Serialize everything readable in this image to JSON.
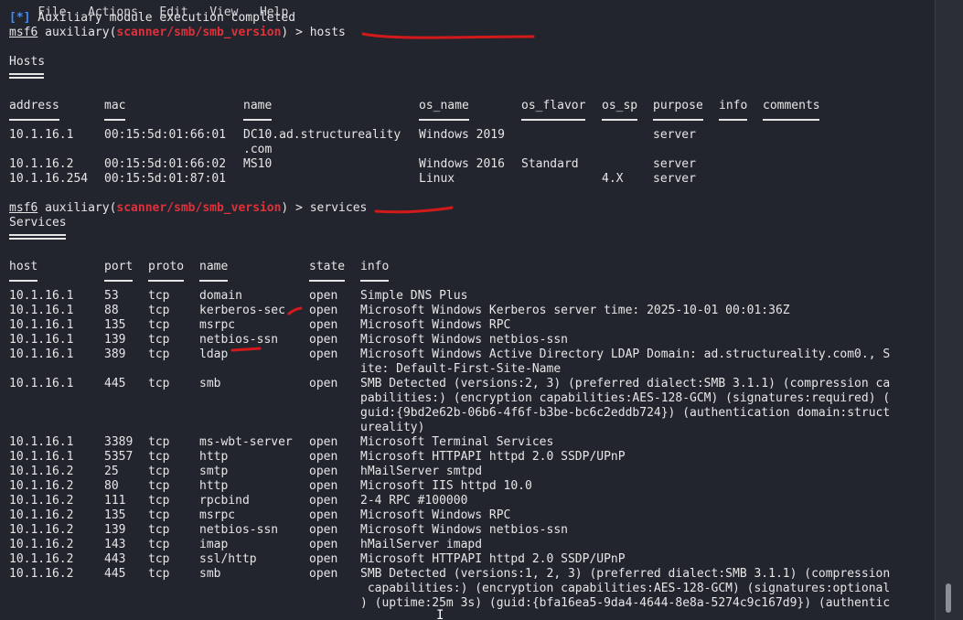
{
  "menu": [
    "File",
    "Actions",
    "Edit",
    "View",
    "Help"
  ],
  "status_prefix": "[*]",
  "status_text": " Auxiliary module execution completed",
  "prompt1": {
    "msf": "msf6",
    "aux": " auxiliary(",
    "module": "scanner/smb/smb_version",
    "tail": ") > hosts"
  },
  "hosts_title": "Hosts",
  "hosts_headers": [
    "address",
    "mac",
    "name",
    "os_name",
    "os_flavor",
    "os_sp",
    "purpose",
    "info",
    "comments"
  ],
  "hosts_rows": [
    [
      "10.1.16.1",
      "00:15:5d:01:66:01",
      "DC10.ad.structureality",
      "Windows 2019",
      "",
      "",
      "server",
      "",
      ""
    ],
    [
      "",
      "",
      ".com",
      "",
      "",
      "",
      "",
      "",
      ""
    ],
    [
      "10.1.16.2",
      "00:15:5d:01:66:02",
      "MS10",
      "Windows 2016",
      "Standard",
      "",
      "server",
      "",
      ""
    ],
    [
      "10.1.16.254",
      "00:15:5d:01:87:01",
      "",
      "Linux",
      "",
      "4.X",
      "server",
      "",
      ""
    ]
  ],
  "prompt2": {
    "msf": "msf6",
    "aux": " auxiliary(",
    "module": "scanner/smb/smb_version",
    "tail": ") > services"
  },
  "services_title": "Services",
  "services_headers": [
    "host",
    "port",
    "proto",
    "name",
    "state",
    "info"
  ],
  "services_rows": [
    [
      "10.1.16.1",
      "53",
      "tcp",
      "domain",
      "open",
      "Simple DNS Plus"
    ],
    [
      "10.1.16.1",
      "88",
      "tcp",
      "kerberos-sec",
      "open",
      "Microsoft Windows Kerberos server time: 2025-10-01 00:01:36Z"
    ],
    [
      "10.1.16.1",
      "135",
      "tcp",
      "msrpc",
      "open",
      "Microsoft Windows RPC"
    ],
    [
      "10.1.16.1",
      "139",
      "tcp",
      "netbios-ssn",
      "open",
      "Microsoft Windows netbios-ssn"
    ],
    [
      "10.1.16.1",
      "389",
      "tcp",
      "ldap",
      "open",
      "Microsoft Windows Active Directory LDAP Domain: ad.structureality.com0., S"
    ],
    [
      "",
      "",
      "",
      "",
      "",
      "ite: Default-First-Site-Name"
    ],
    [
      "10.1.16.1",
      "445",
      "tcp",
      "smb",
      "open",
      "SMB Detected (versions:2, 3) (preferred dialect:SMB 3.1.1) (compression ca"
    ],
    [
      "",
      "",
      "",
      "",
      "",
      "pabilities:) (encryption capabilities:AES-128-GCM) (signatures:required) ("
    ],
    [
      "",
      "",
      "",
      "",
      "",
      "guid:{9bd2e62b-06b6-4f6f-b3be-bc6c2eddb724}) (authentication domain:struct"
    ],
    [
      "",
      "",
      "",
      "",
      "",
      "ureality)"
    ],
    [
      "10.1.16.1",
      "3389",
      "tcp",
      "ms-wbt-server",
      "open",
      "Microsoft Terminal Services"
    ],
    [
      "10.1.16.1",
      "5357",
      "tcp",
      "http",
      "open",
      "Microsoft HTTPAPI httpd 2.0 SSDP/UPnP"
    ],
    [
      "10.1.16.2",
      "25",
      "tcp",
      "smtp",
      "open",
      "hMailServer smtpd"
    ],
    [
      "10.1.16.2",
      "80",
      "tcp",
      "http",
      "open",
      "Microsoft IIS httpd 10.0"
    ],
    [
      "10.1.16.2",
      "111",
      "tcp",
      "rpcbind",
      "open",
      "2-4 RPC #100000"
    ],
    [
      "10.1.16.2",
      "135",
      "tcp",
      "msrpc",
      "open",
      "Microsoft Windows RPC"
    ],
    [
      "10.1.16.2",
      "139",
      "tcp",
      "netbios-ssn",
      "open",
      "Microsoft Windows netbios-ssn"
    ],
    [
      "10.1.16.2",
      "143",
      "tcp",
      "imap",
      "open",
      "hMailServer imapd"
    ],
    [
      "10.1.16.2",
      "443",
      "tcp",
      "ssl/http",
      "open",
      "Microsoft HTTPAPI httpd 2.0 SSDP/UPnP"
    ],
    [
      "10.1.16.2",
      "445",
      "tcp",
      "smb",
      "open",
      "SMB Detected (versions:1, 2, 3) (preferred dialect:SMB 3.1.1) (compression"
    ],
    [
      "",
      "",
      "",
      "",
      "",
      " capabilities:) (encryption capabilities:AES-128-GCM) (signatures:optional"
    ],
    [
      "",
      "",
      "",
      "",
      "",
      ") (uptime:25m 3s) (guid:{bfa16ea5-9da4-4644-8e8a-5274c9c167d9}) (authentic"
    ]
  ],
  "colors": {
    "background": "#22252d",
    "text": "#e6e6e6",
    "msf_blue": "#3c8dff",
    "module_red": "#e0303a",
    "annotation_red": "#d21a1a"
  }
}
